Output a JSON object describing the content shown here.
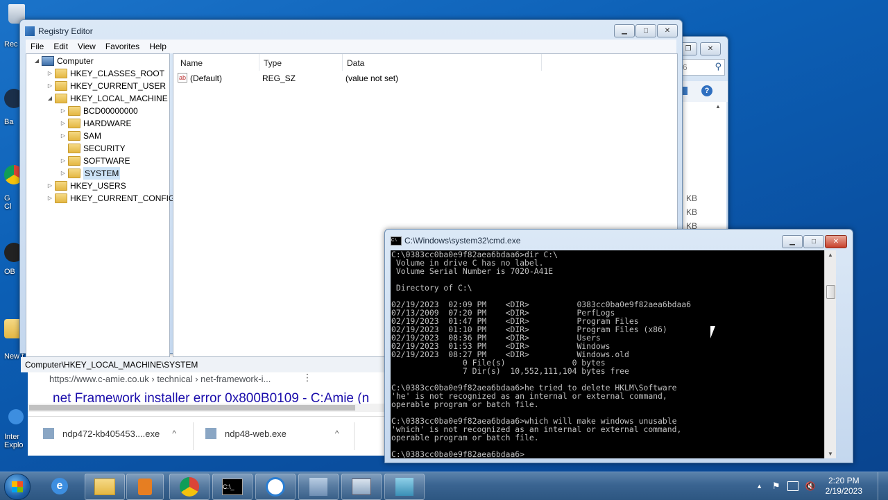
{
  "desktop": {
    "icons": [
      {
        "label": "Rec",
        "icon": "recycle-bin-icon"
      },
      {
        "label": "Ba",
        "icon": "backup-icon"
      },
      {
        "label": "G",
        "icon": "chrome-icon",
        "label2": "Cl"
      },
      {
        "label": "OB",
        "icon": "obs-icon"
      },
      {
        "label": "New f",
        "icon": "folder-icon"
      },
      {
        "label": "Inter",
        "icon": "ie-icon",
        "label2": "Explo"
      }
    ]
  },
  "back_window": {
    "search_placeholder": "6",
    "sizes": [
      "KB",
      "KB",
      "KB"
    ]
  },
  "registry": {
    "title": "Registry Editor",
    "menu": [
      "File",
      "Edit",
      "View",
      "Favorites",
      "Help"
    ],
    "tree": [
      {
        "label": "Computer",
        "level": 0,
        "arrow": "◢",
        "kind": "computer"
      },
      {
        "label": "HKEY_CLASSES_ROOT",
        "level": 1,
        "arrow": "▷"
      },
      {
        "label": "HKEY_CURRENT_USER",
        "level": 1,
        "arrow": "▷"
      },
      {
        "label": "HKEY_LOCAL_MACHINE",
        "level": 1,
        "arrow": "◢"
      },
      {
        "label": "BCD00000000",
        "level": 2,
        "arrow": "▷"
      },
      {
        "label": "HARDWARE",
        "level": 2,
        "arrow": "▷"
      },
      {
        "label": "SAM",
        "level": 2,
        "arrow": "▷"
      },
      {
        "label": "SECURITY",
        "level": 2,
        "arrow": ""
      },
      {
        "label": "SOFTWARE",
        "level": 2,
        "arrow": "▷"
      },
      {
        "label": "SYSTEM",
        "level": 2,
        "arrow": "▷",
        "selected": true
      },
      {
        "label": "HKEY_USERS",
        "level": 1,
        "arrow": "▷"
      },
      {
        "label": "HKEY_CURRENT_CONFIG",
        "level": 1,
        "arrow": "▷"
      }
    ],
    "columns": {
      "name": "Name",
      "type": "Type",
      "data": "Data"
    },
    "values": [
      {
        "name": "(Default)",
        "type": "REG_SZ",
        "data": "(value not set)"
      }
    ],
    "status": "Computer\\HKEY_LOCAL_MACHINE\\SYSTEM"
  },
  "browser": {
    "url": "https://www.c-amie.co.uk › technical › net-framework-i...",
    "link": "net Framework installer error 0x800B0109 - C:Amie (n",
    "downloads": [
      {
        "name": "ndp472-kb405453....exe"
      },
      {
        "name": "ndp48-web.exe"
      }
    ]
  },
  "cmd": {
    "title": "C:\\Windows\\system32\\cmd.exe",
    "lines": [
      "C:\\0383cc0ba0e9f82aea6bdaa6>dir C:\\",
      " Volume in drive C has no label.",
      " Volume Serial Number is 7020-A41E",
      "",
      " Directory of C:\\",
      "",
      "02/19/2023  02:09 PM    <DIR>          0383cc0ba0e9f82aea6bdaa6",
      "07/13/2009  07:20 PM    <DIR>          PerfLogs",
      "02/19/2023  01:47 PM    <DIR>          Program Files",
      "02/19/2023  01:10 PM    <DIR>          Program Files (x86)",
      "02/19/2023  08:36 PM    <DIR>          Users",
      "02/19/2023  01:53 PM    <DIR>          Windows",
      "02/19/2023  08:27 PM    <DIR>          Windows.old",
      "               0 File(s)              0 bytes",
      "               7 Dir(s)  10,552,111,104 bytes free",
      "",
      "C:\\0383cc0ba0e9f82aea6bdaa6>he tried to delete HKLM\\Software",
      "'he' is not recognized as an internal or external command,",
      "operable program or batch file.",
      "",
      "C:\\0383cc0ba0e9f82aea6bdaa6>which will make windows unusable",
      "'which' is not recognized as an internal or external command,",
      "operable program or batch file.",
      "",
      "C:\\0383cc0ba0e9f82aea6bdaa6>_"
    ]
  },
  "taskbar": {
    "apps": [
      "start-orb-icon",
      "ie-icon",
      "explorer-icon",
      "media-player-icon",
      "chrome-icon",
      "cmd-icon",
      "obs-icon",
      "network-tool-icon",
      "remote-desktop-icon",
      "installer-icon"
    ],
    "time": "2:20 PM",
    "date": "2/19/2023"
  },
  "colors": {
    "selection": "#cde3f7",
    "cmd_text": "#c0c0c0",
    "taskbar": "#3a6491"
  }
}
